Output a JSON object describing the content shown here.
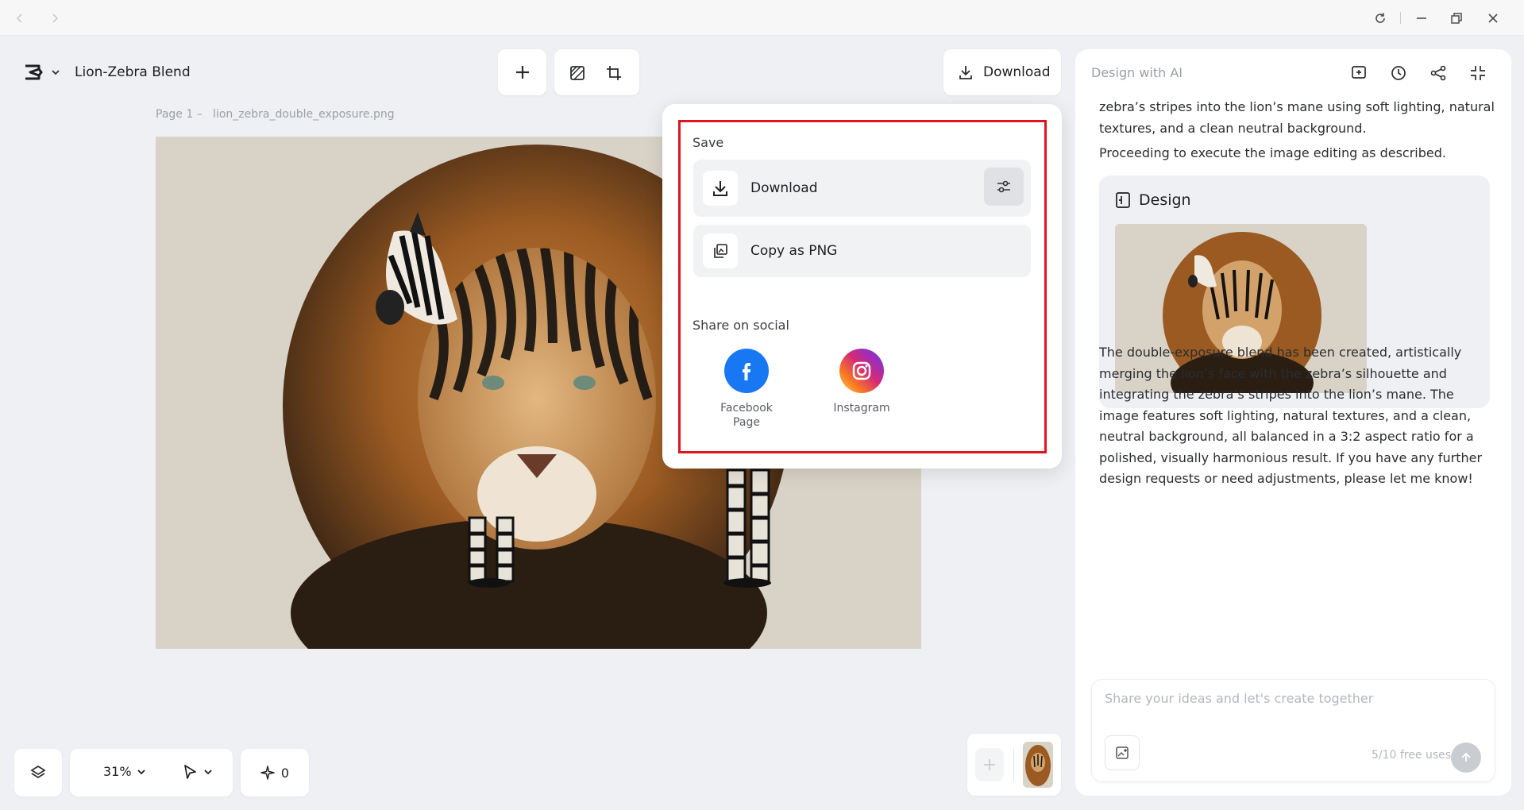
{
  "app": {
    "project_title": "Lion-Zebra Blend",
    "page_label": "Page 1 –   lion_zebra_double_exposure.png",
    "download_label": "Download"
  },
  "popover": {
    "save_heading": "Save",
    "download_label": "Download",
    "copy_label": "Copy as PNG",
    "share_heading": "Share on social",
    "social": [
      {
        "label": "Facebook\nPage",
        "label_line1": "Facebook",
        "label_line2": "Page",
        "color": "#1877F2"
      },
      {
        "label": "Instagram",
        "color": "#E1306C"
      }
    ]
  },
  "ai": {
    "title": "Design with AI",
    "msg_top": "zebra’s stripes into the lion’s mane using soft lighting, natural textures, and a clean neutral background.",
    "msg_proceed": "Proceeding to execute the image editing as described.",
    "design_label": "Design",
    "msg_result": "The double-exposure blend has been created, artistically merging the lion’s face with the zebra’s silhouette and integrating the zebra’s stripes into the lion’s mane. The image features soft lighting, natural textures, and a clean, neutral background, all balanced in a 3:2 aspect ratio for a polished, visually harmonious result. If you have any further design requests or need adjustments, please let me know!",
    "chat_placeholder": "Share your ideas and let's create together",
    "free_uses": "5/10 free uses"
  },
  "toolbar": {
    "zoom": "31%",
    "credits": "0"
  },
  "colors": {
    "highlight": "#e0141e",
    "facebook": "#1877F2",
    "instagram_start": "#FEDA75",
    "instagram_mid": "#D62976",
    "instagram_end": "#4F5BD5"
  }
}
